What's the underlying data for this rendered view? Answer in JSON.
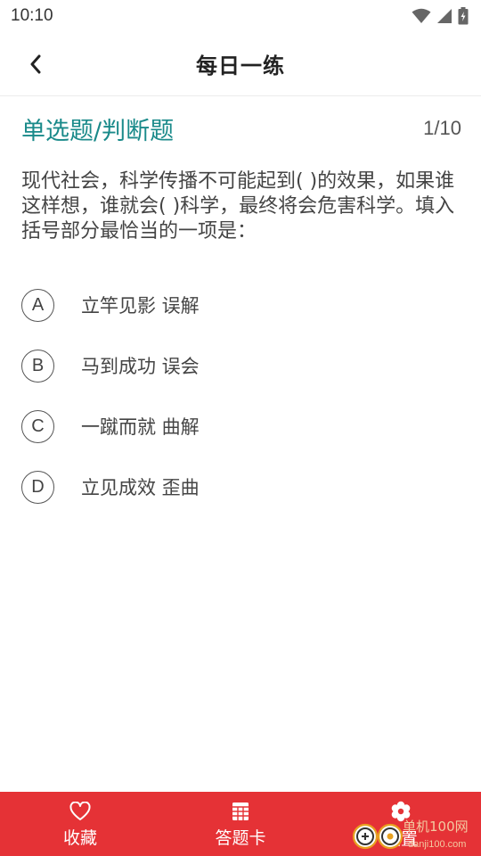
{
  "status_bar": {
    "time": "10:10",
    "icons": [
      "wifi-icon",
      "signal-icon",
      "battery-charging-icon"
    ]
  },
  "header": {
    "title": "每日一练",
    "back_icon": "chevron-left-icon"
  },
  "question": {
    "type": "单选题/判断题",
    "progress": "1/10",
    "text": "现代社会，科学传播不可能起到( )的效果，如果谁这样想，谁就会( )科学，最终将会危害科学。填入括号部分最恰当的一项是：",
    "options": [
      {
        "letter": "A",
        "text": "立竿见影 误解"
      },
      {
        "letter": "B",
        "text": "马到成功 误会"
      },
      {
        "letter": "C",
        "text": "一蹴而就 曲解"
      },
      {
        "letter": "D",
        "text": "立见成效 歪曲"
      }
    ]
  },
  "bottom_nav": {
    "items": [
      {
        "label": "收藏",
        "icon": "heart-icon"
      },
      {
        "label": "答题卡",
        "icon": "grid-card-icon"
      },
      {
        "label": "设置",
        "icon": "gear-icon"
      }
    ]
  },
  "watermark": {
    "brand": "单机100网",
    "url": "danji100.com"
  },
  "colors": {
    "accent": "#1a8a8a",
    "bottom_bar": "#e53236",
    "text": "#444444"
  }
}
